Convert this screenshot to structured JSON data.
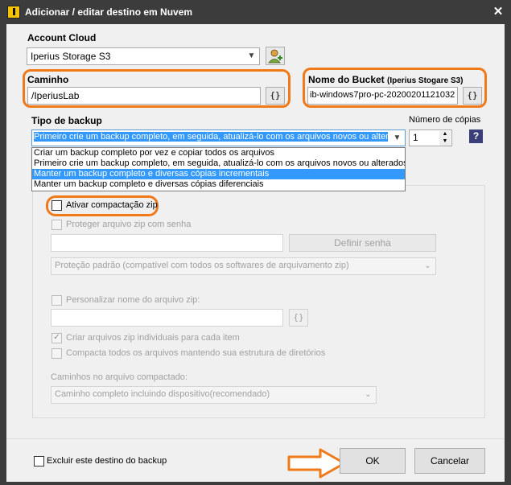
{
  "window": {
    "title": "Adicionar / editar destino em Nuvem",
    "close_glyph": "✕"
  },
  "account": {
    "label": "Account Cloud",
    "value": "Iperius Storage S3"
  },
  "path": {
    "label": "Caminho",
    "value": "/IperiusLab",
    "var_button": "{}"
  },
  "bucket": {
    "label": "Nome do Bucket",
    "label_hint": "(Iperius Stogare S3)",
    "value": "ib-windows7pro-pc-20200201121032",
    "var_button": "{}"
  },
  "backup_type": {
    "label": "Tipo de backup",
    "selected": "Primeiro crie um backup completo, em seguida, atualizá-lo com os arquivos novos ou alterados",
    "options": [
      "Criar um backup completo por vez e copiar todos os arquivos",
      "Primeiro crie um backup completo, em seguida, atualizá-lo com os arquivos novos ou alterados",
      "Manter um backup completo e diversas cópias incrementais",
      "Manter um backup completo e diversas cópias diferenciais"
    ],
    "highlighted_index": 2
  },
  "copies": {
    "label": "Número de cópias",
    "value": "1",
    "help": "?"
  },
  "zip": {
    "enable_label": "Ativar compactação zip",
    "password_label": "Proteger arquivo zip com senha",
    "define_password": "Definir senha",
    "protection_value": "Proteção padrão (compatível com todos os softwares de arquivamento zip)",
    "custom_name_label": "Personalizar nome do arquivo zip:",
    "name_var_button": "{}",
    "individual_label": "Criar arquivos zip individuais para cada item",
    "structure_label": "Compacta todos os arquivos mantendo sua estrutura de diretórios",
    "paths_label": "Caminhos no arquivo compactado:",
    "paths_value": "Caminho completo incluindo dispositivo(recomendado)"
  },
  "footer": {
    "exclude_label": "Excluir este destino do backup",
    "ok": "OK",
    "cancel": "Cancelar"
  },
  "colors": {
    "highlight": "#f07a1a",
    "selection": "#3399ff",
    "titlebar": "#3c3c3c"
  }
}
